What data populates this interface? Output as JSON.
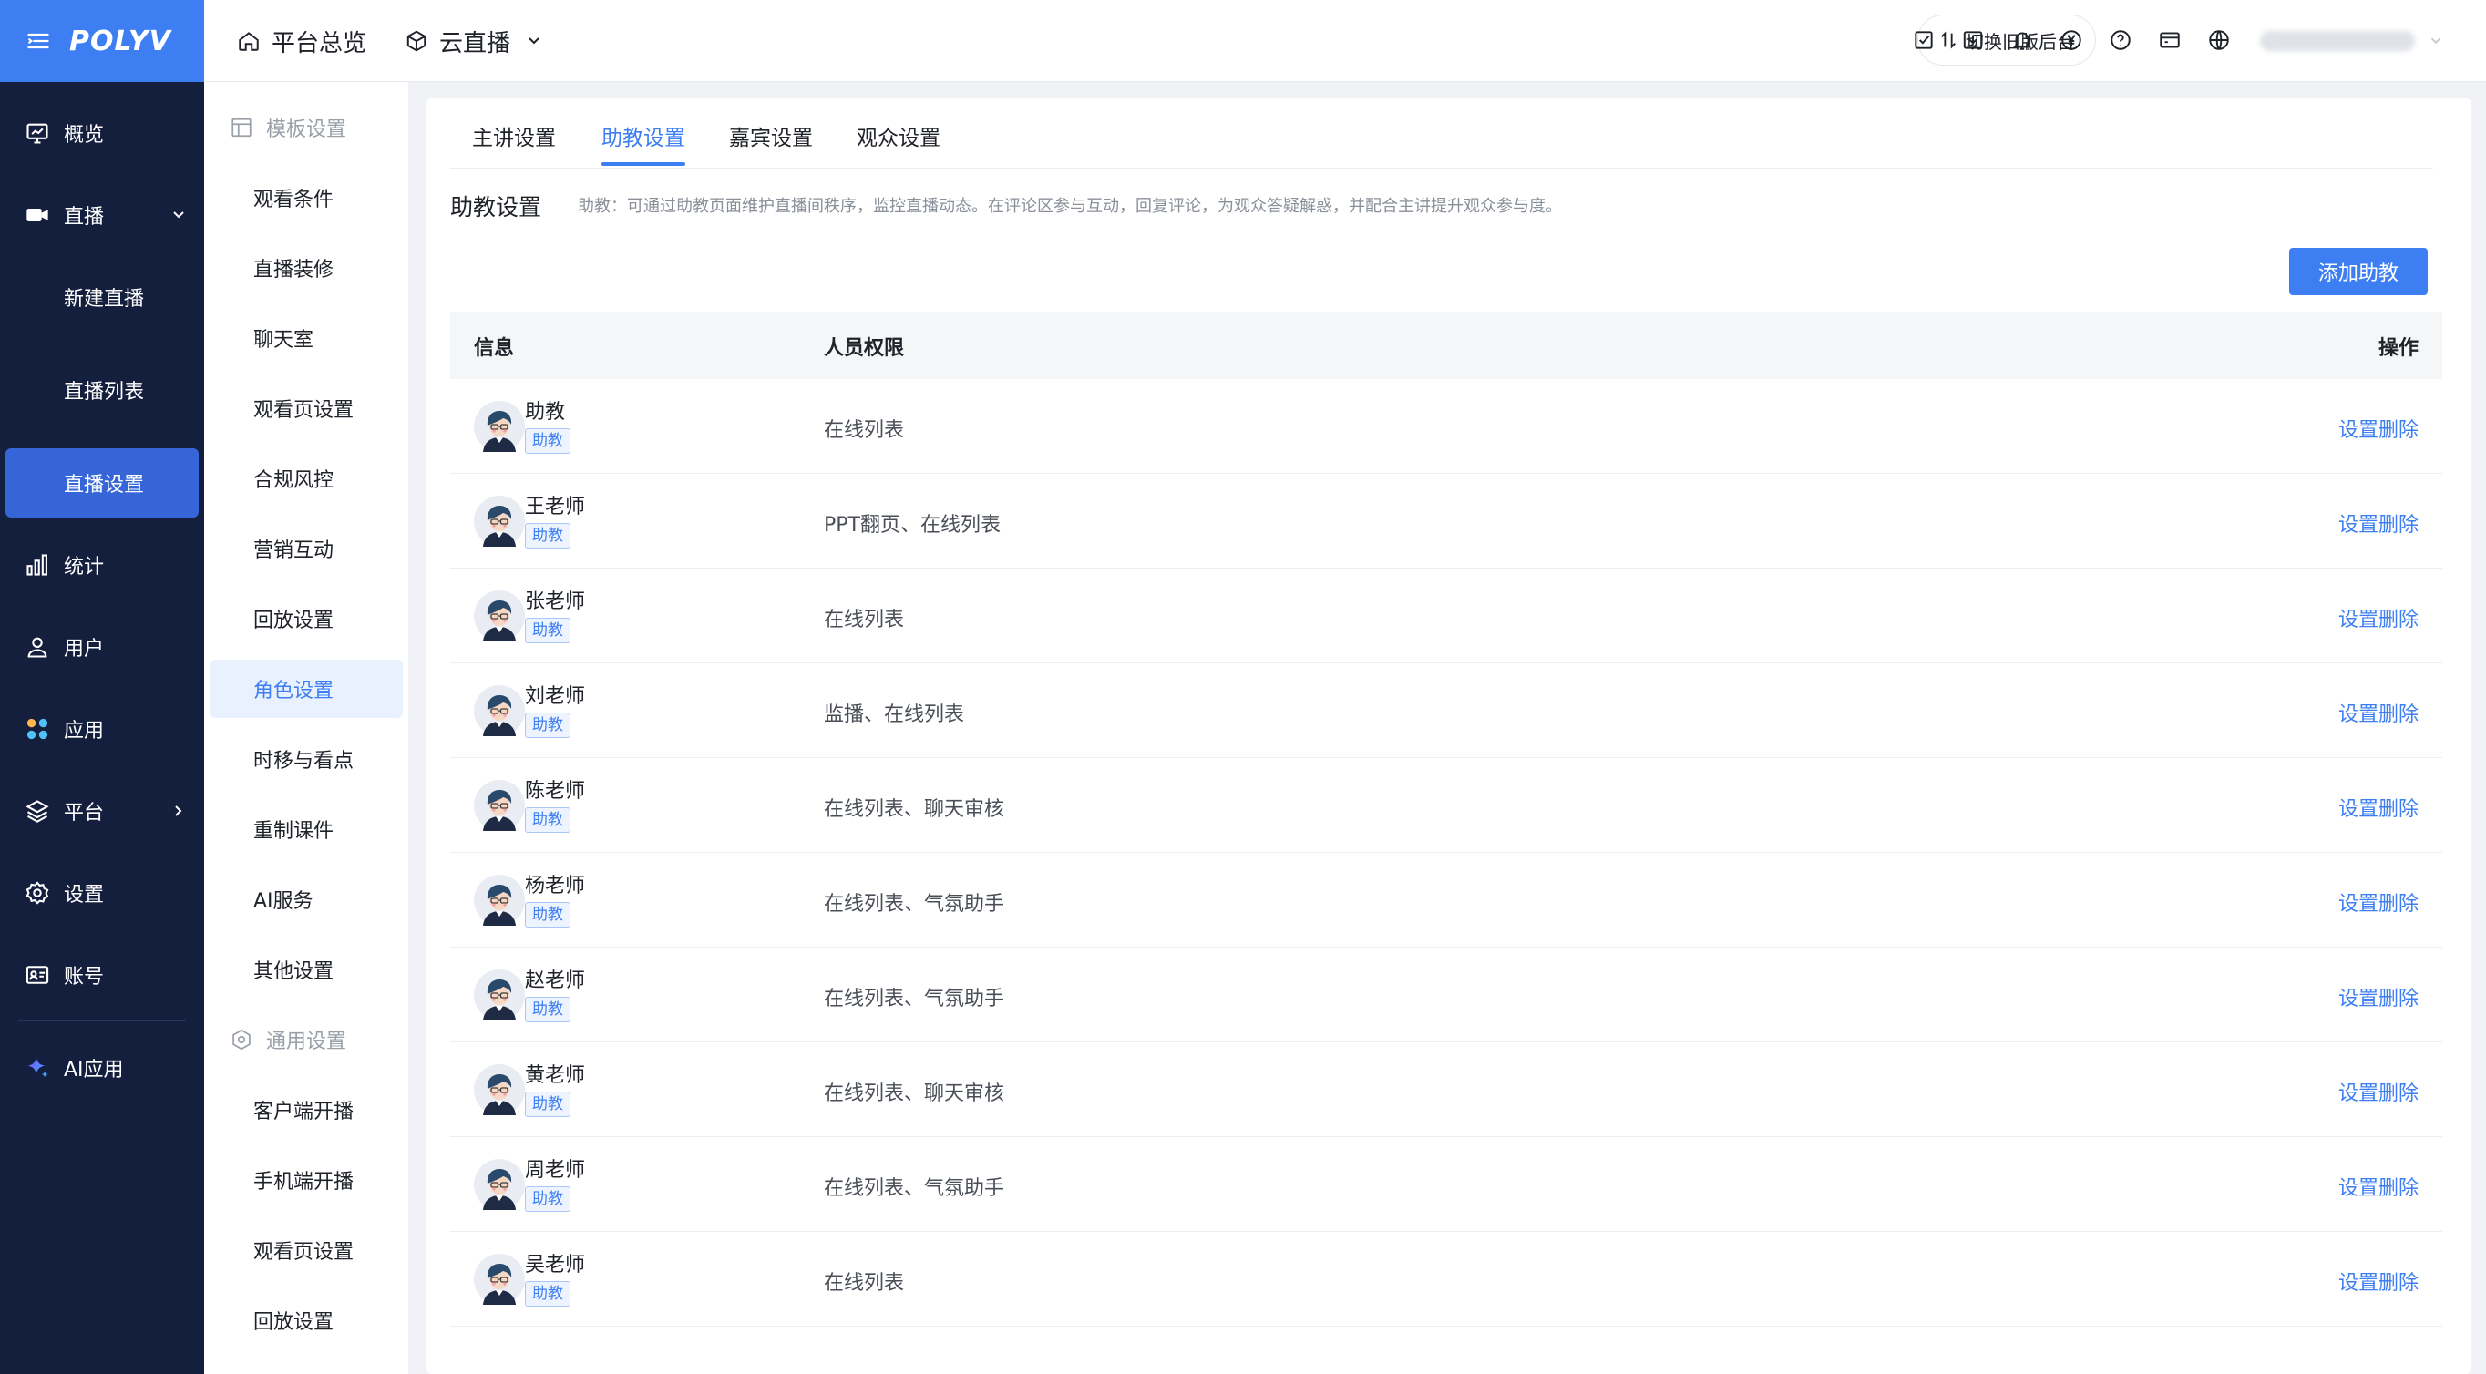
{
  "brand": {
    "logo": "POLYV",
    "accent": "#3d7ff3",
    "sidebar_bg": "#141e3d"
  },
  "sidebar": {
    "items": [
      {
        "label": "概览",
        "icon": "monitor-chart-icon"
      },
      {
        "label": "直播",
        "icon": "video-camera-icon",
        "expanded": true
      },
      {
        "label": "新建直播"
      },
      {
        "label": "直播列表"
      },
      {
        "label": "直播设置",
        "active": true
      },
      {
        "label": "统计",
        "icon": "bar-chart-icon"
      },
      {
        "label": "用户",
        "icon": "user-icon"
      },
      {
        "label": "应用",
        "icon": "apps-grid-icon"
      },
      {
        "label": "平台",
        "icon": "layers-icon"
      },
      {
        "label": "设置",
        "icon": "gear-icon"
      },
      {
        "label": "账号",
        "icon": "id-card-icon"
      },
      {
        "label": "AI应用",
        "icon": "sparkle-icon"
      }
    ]
  },
  "header": {
    "home": "平台总览",
    "product": "云直播",
    "switch_old": "切换旧版后台",
    "icons": [
      "todo-icon",
      "download-icon",
      "bell-icon",
      "yuan-icon",
      "help-icon",
      "card-icon",
      "globe-icon"
    ]
  },
  "submenu": {
    "group1": "模板设置",
    "items1": [
      "观看条件",
      "直播装修",
      "聊天室",
      "观看页设置",
      "合规风控",
      "营销互动",
      "回放设置",
      "角色设置",
      "时移与看点",
      "重制课件",
      "AI服务",
      "其他设置"
    ],
    "active": "角色设置",
    "group2": "通用设置",
    "items2": [
      "客户端开播",
      "手机端开播",
      "观看页设置",
      "回放设置"
    ]
  },
  "main": {
    "tabs": [
      {
        "label": "主讲设置"
      },
      {
        "label": "助教设置",
        "active": true
      },
      {
        "label": "嘉宾设置"
      },
      {
        "label": "观众设置"
      }
    ],
    "section_title": "助教设置",
    "section_desc": "助教：可通过助教页面维护直播间秩序，监控直播动态。在评论区参与互动，回复评论，为观众答疑解惑，并配合主讲提升观众参与度。",
    "add_button": "添加助教",
    "table": {
      "headers": {
        "info": "信息",
        "perm": "人员权限",
        "ops": "操作"
      },
      "rows": [
        {
          "name": "助教",
          "tag": "助教",
          "perm": "在线列表",
          "set": "设置",
          "del": "删除"
        },
        {
          "name": "王老师",
          "tag": "助教",
          "perm": "PPT翻页、在线列表",
          "set": "设置",
          "del": "删除"
        },
        {
          "name": "张老师",
          "tag": "助教",
          "perm": "在线列表",
          "set": "设置",
          "del": "删除"
        },
        {
          "name": "刘老师",
          "tag": "助教",
          "perm": "监播、在线列表",
          "set": "设置",
          "del": "删除"
        },
        {
          "name": "陈老师",
          "tag": "助教",
          "perm": "在线列表、聊天审核",
          "set": "设置",
          "del": "删除"
        },
        {
          "name": "杨老师",
          "tag": "助教",
          "perm": "在线列表、气氛助手",
          "set": "设置",
          "del": "删除"
        },
        {
          "name": "赵老师",
          "tag": "助教",
          "perm": "在线列表、气氛助手",
          "set": "设置",
          "del": "删除"
        },
        {
          "name": "黄老师",
          "tag": "助教",
          "perm": "在线列表、聊天审核",
          "set": "设置",
          "del": "删除"
        },
        {
          "name": "周老师",
          "tag": "助教",
          "perm": "在线列表、气氛助手",
          "set": "设置",
          "del": "删除"
        },
        {
          "name": "吴老师",
          "tag": "助教",
          "perm": "在线列表",
          "set": "设置",
          "del": "删除"
        }
      ]
    }
  }
}
